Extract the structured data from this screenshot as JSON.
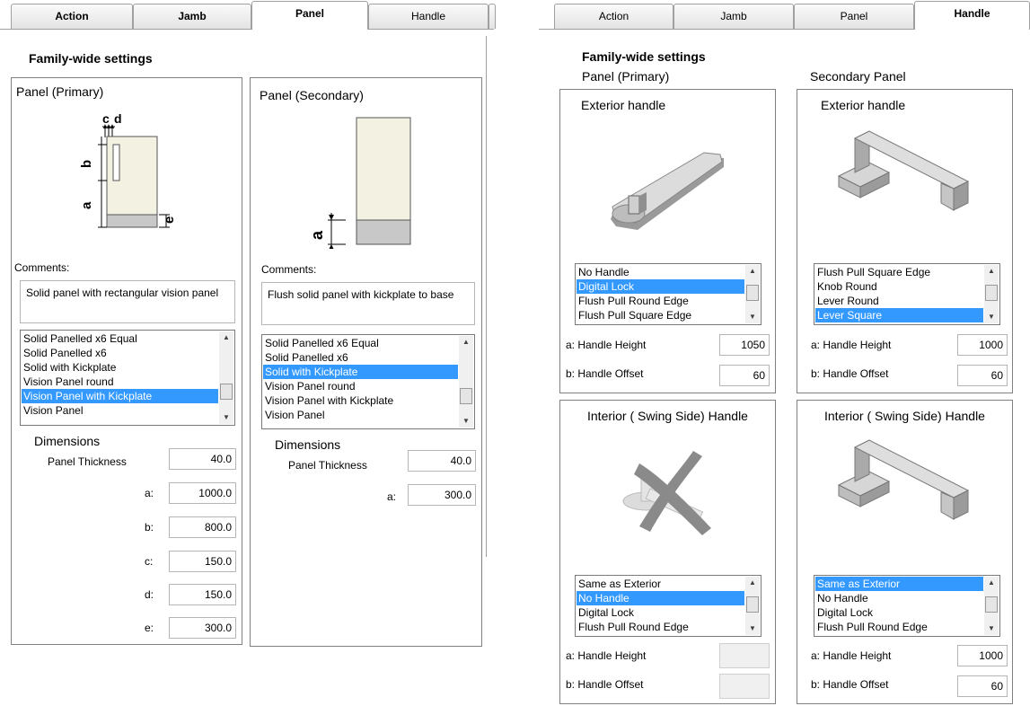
{
  "left_panel": {
    "tabs": [
      "Action",
      "Jamb",
      "Panel",
      "Handle"
    ],
    "active_tab": "Panel",
    "heading": "Family-wide settings",
    "primary": {
      "title": "Panel (Primary)",
      "diagram_labels": {
        "c": "c",
        "d": "d",
        "b": "b",
        "a": "a",
        "e": "e"
      },
      "comments_label": "Comments:",
      "comment": "Solid panel with rectangular vision panel",
      "list": [
        "Solid Panelled x6 Equal",
        "Solid Panelled x6",
        "Solid with Kickplate",
        "Vision Panel round",
        "Vision Panel with Kickplate",
        "Vision Panel"
      ],
      "selected": "Vision Panel with Kickplate",
      "dimensions_label": "Dimensions",
      "panel_thickness_label": "Panel Thickness",
      "panel_thickness": "40.0",
      "dims": [
        {
          "label": "a:",
          "value": "1000.0"
        },
        {
          "label": "b:",
          "value": "800.0"
        },
        {
          "label": "c:",
          "value": "150.0"
        },
        {
          "label": "d:",
          "value": "150.0"
        },
        {
          "label": "e:",
          "value": "300.0"
        }
      ]
    },
    "secondary": {
      "title": "Panel (Secondary)",
      "diagram_labels": {
        "a": "a"
      },
      "comments_label": "Comments:",
      "comment": "Flush solid panel with kickplate to base",
      "list": [
        "Solid Panelled x6 Equal",
        "Solid Panelled x6",
        "Solid with Kickplate",
        "Vision Panel round",
        "Vision Panel with Kickplate",
        "Vision Panel"
      ],
      "selected": "Solid with Kickplate",
      "dimensions_label": "Dimensions",
      "panel_thickness_label": "Panel Thickness",
      "panel_thickness": "40.0",
      "dims": [
        {
          "label": "a:",
          "value": "300.0"
        }
      ]
    }
  },
  "right_panel": {
    "tabs": [
      "Action",
      "Jamb",
      "Panel",
      "Handle"
    ],
    "active_tab": "Handle",
    "heading": "Family-wide settings",
    "col_primary": "Panel (Primary)",
    "col_secondary": "Secondary Panel",
    "boxes": {
      "p_ext": {
        "title": "Exterior handle",
        "list": [
          "No Handle",
          "Digital Lock",
          "Flush Pull Round Edge",
          "Flush Pull Square Edge"
        ],
        "selected": "Digital Lock",
        "height_label": "a: Handle Height",
        "height": "1050",
        "offset_label": "b: Handle Offset",
        "offset": "60"
      },
      "s_ext": {
        "title": "Exterior handle",
        "list": [
          "Flush Pull Square Edge",
          "Knob Round",
          "Lever Round",
          "Lever Square"
        ],
        "selected": "Lever Square",
        "height_label": "a: Handle Height",
        "height": "1000",
        "offset_label": "b: Handle Offset",
        "offset": "60"
      },
      "p_int": {
        "title": "Interior ( Swing Side) Handle",
        "list": [
          "Same as Exterior",
          "No Handle",
          "Digital Lock",
          "Flush Pull Round Edge"
        ],
        "selected": "No Handle",
        "height_label": "a: Handle Height",
        "height": "",
        "offset_label": "b: Handle Offset",
        "offset": ""
      },
      "s_int": {
        "title": "Interior ( Swing Side) Handle",
        "list": [
          "Same as Exterior",
          "No Handle",
          "Digital Lock",
          "Flush Pull Round Edge"
        ],
        "selected": "Same as Exterior",
        "height_label": "a: Handle Height",
        "height": "1000",
        "offset_label": "b: Handle Offset",
        "offset": "60"
      }
    }
  },
  "colors": {
    "selection": "#3399ff",
    "panel_fill": "#f3f1e2",
    "kickplate_fill": "#c8c8c8"
  }
}
